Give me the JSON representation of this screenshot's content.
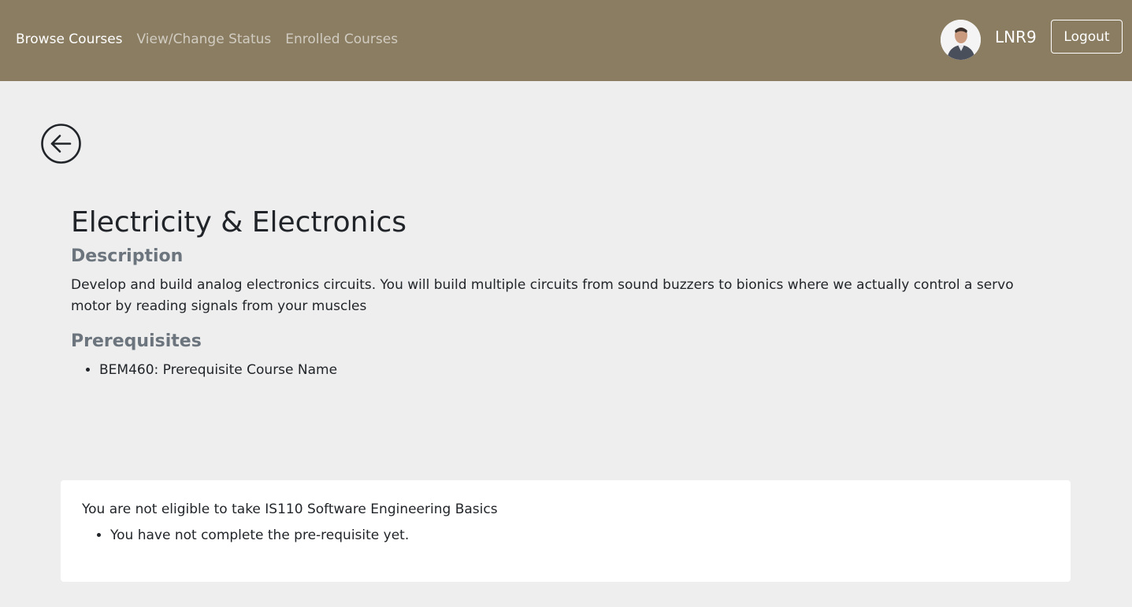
{
  "nav": {
    "links": [
      {
        "label": "Browse Courses",
        "active": true
      },
      {
        "label": "View/Change Status",
        "active": false
      },
      {
        "label": "Enrolled Courses",
        "active": false
      }
    ],
    "username": "LNR9",
    "logout_label": "Logout",
    "avatar_icon": "user-avatar",
    "background_color": "#8b7d62"
  },
  "back_icon": "arrow-left-circle-icon",
  "course": {
    "title": "Electricity & Electronics",
    "description_heading": "Description",
    "description": "Develop and build analog electronics circuits. You will build multiple circuits from sound buzzers to bionics where we actually control a servo motor by reading signals from your muscles",
    "prerequisites_heading": "Prerequisites",
    "prerequisites": [
      "BEM460: Prerequisite Course Name"
    ]
  },
  "eligibility": {
    "message": "You are not eligible to take IS110 Software Engineering Basics",
    "reasons": [
      "You have not complete the pre-requisite yet."
    ]
  }
}
